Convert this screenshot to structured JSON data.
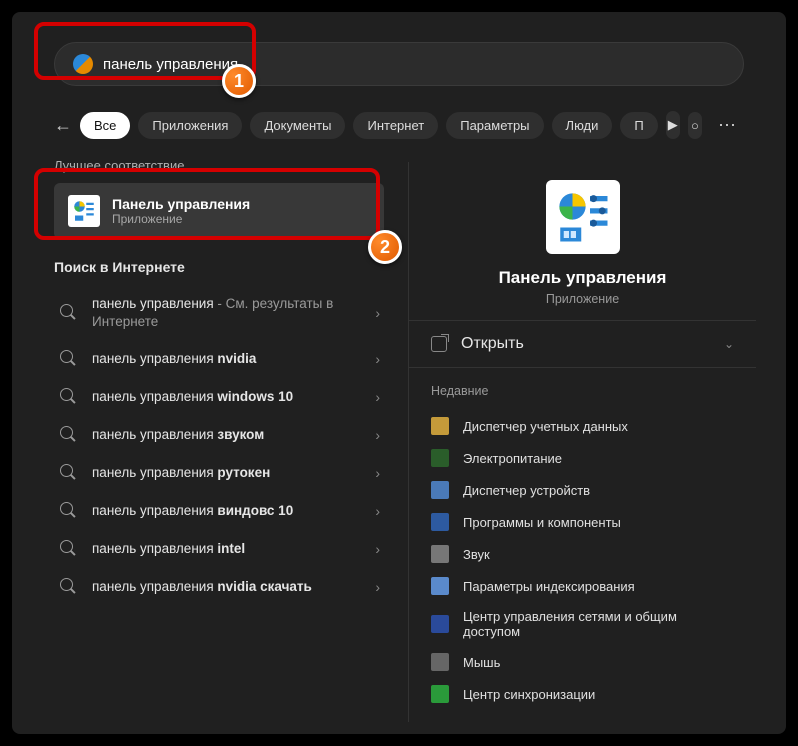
{
  "search": {
    "value": "панель управления"
  },
  "filters": {
    "items": [
      "Все",
      "Приложения",
      "Документы",
      "Интернет",
      "Параметры",
      "Люди",
      "П"
    ]
  },
  "left": {
    "best_label": "Лучшее соответствие",
    "best_title": "Панель управления",
    "best_sub": "Приложение",
    "web_label": "Поиск в Интернете",
    "web_items": [
      {
        "prefix": "панель управления",
        "bold": "",
        "suffix": " - См. результаты в Интернете"
      },
      {
        "prefix": "панель управления ",
        "bold": "nvidia",
        "suffix": ""
      },
      {
        "prefix": "панель управления ",
        "bold": "windows 10",
        "suffix": ""
      },
      {
        "prefix": "панель управления ",
        "bold": "звуком",
        "suffix": ""
      },
      {
        "prefix": "панель управления ",
        "bold": "рутокен",
        "suffix": ""
      },
      {
        "prefix": "панель управления ",
        "bold": "виндовс 10",
        "suffix": ""
      },
      {
        "prefix": "панель управления ",
        "bold": "intel",
        "suffix": ""
      },
      {
        "prefix": "панель управления ",
        "bold": "nvidia скачать",
        "suffix": ""
      }
    ]
  },
  "right": {
    "title": "Панель управления",
    "sub": "Приложение",
    "open": "Открыть",
    "recent_label": "Недавние",
    "recent": [
      {
        "icon": "ico-cred",
        "label": "Диспетчер учетных данных"
      },
      {
        "icon": "ico-power",
        "label": "Электропитание"
      },
      {
        "icon": "ico-dev",
        "label": "Диспетчер устройств"
      },
      {
        "icon": "ico-prog",
        "label": "Программы и компоненты"
      },
      {
        "icon": "ico-sound",
        "label": "Звук"
      },
      {
        "icon": "ico-idx",
        "label": "Параметры индексирования"
      },
      {
        "icon": "ico-net",
        "label": "Центр управления сетями и общим доступом"
      },
      {
        "icon": "ico-mouse",
        "label": "Мышь"
      },
      {
        "icon": "ico-sync",
        "label": "Центр синхронизации"
      }
    ]
  },
  "badges": {
    "one": "1",
    "two": "2"
  }
}
